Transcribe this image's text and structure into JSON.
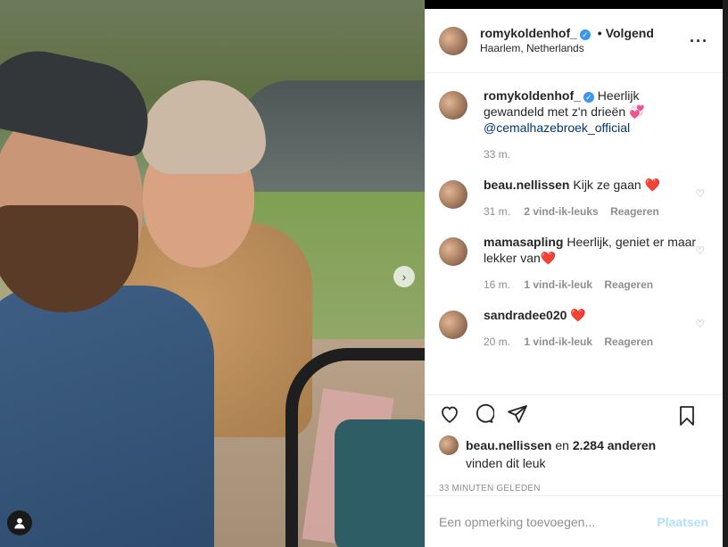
{
  "post": {
    "username": "romykoldenhof_",
    "follow_separator": "•",
    "follow_label": "Volgend",
    "location": "Haarlem, Netherlands"
  },
  "caption": {
    "username": "romykoldenhof_",
    "text": "Heerlijk gewandeld met z'n drieën 💞",
    "mention": "@cemalhazebroek_official",
    "time": "33 m."
  },
  "comments": [
    {
      "username": "beau.nellissen",
      "text": "Kijk ze gaan ❤️",
      "time": "31 m.",
      "likes": "2 vind-ik-leuks",
      "reply": "Reageren"
    },
    {
      "username": "mamasapling",
      "text": "Heerlijk, geniet er maar lekker van❤️",
      "time": "16 m.",
      "likes": "1 vind-ik-leuk",
      "reply": "Reageren"
    },
    {
      "username": "sandradee020",
      "text": "❤️",
      "time": "20 m.",
      "likes": "1 vind-ik-leuk",
      "reply": "Reageren"
    }
  ],
  "likes": {
    "first_user": "beau.nellissen",
    "connector": "en",
    "others": "2.284 anderen",
    "suffix": "vinden dit leuk"
  },
  "timestamp": "33 MINUTEN GELEDEN",
  "comment_input": {
    "placeholder": "Een opmerking toevoegen...",
    "post_label": "Plaatsen"
  },
  "icons": {
    "heart": "heart-icon",
    "comment": "comment-icon",
    "share": "share-icon",
    "save": "bookmark-icon",
    "more": "more-icon",
    "next": "chevron-right-icon",
    "user_tag": "user-icon"
  },
  "colors": {
    "verified": "#3897f0",
    "link": "#00376b",
    "post_button_disabled": "#b2dffc",
    "secondary_text": "#8e8e8e"
  }
}
